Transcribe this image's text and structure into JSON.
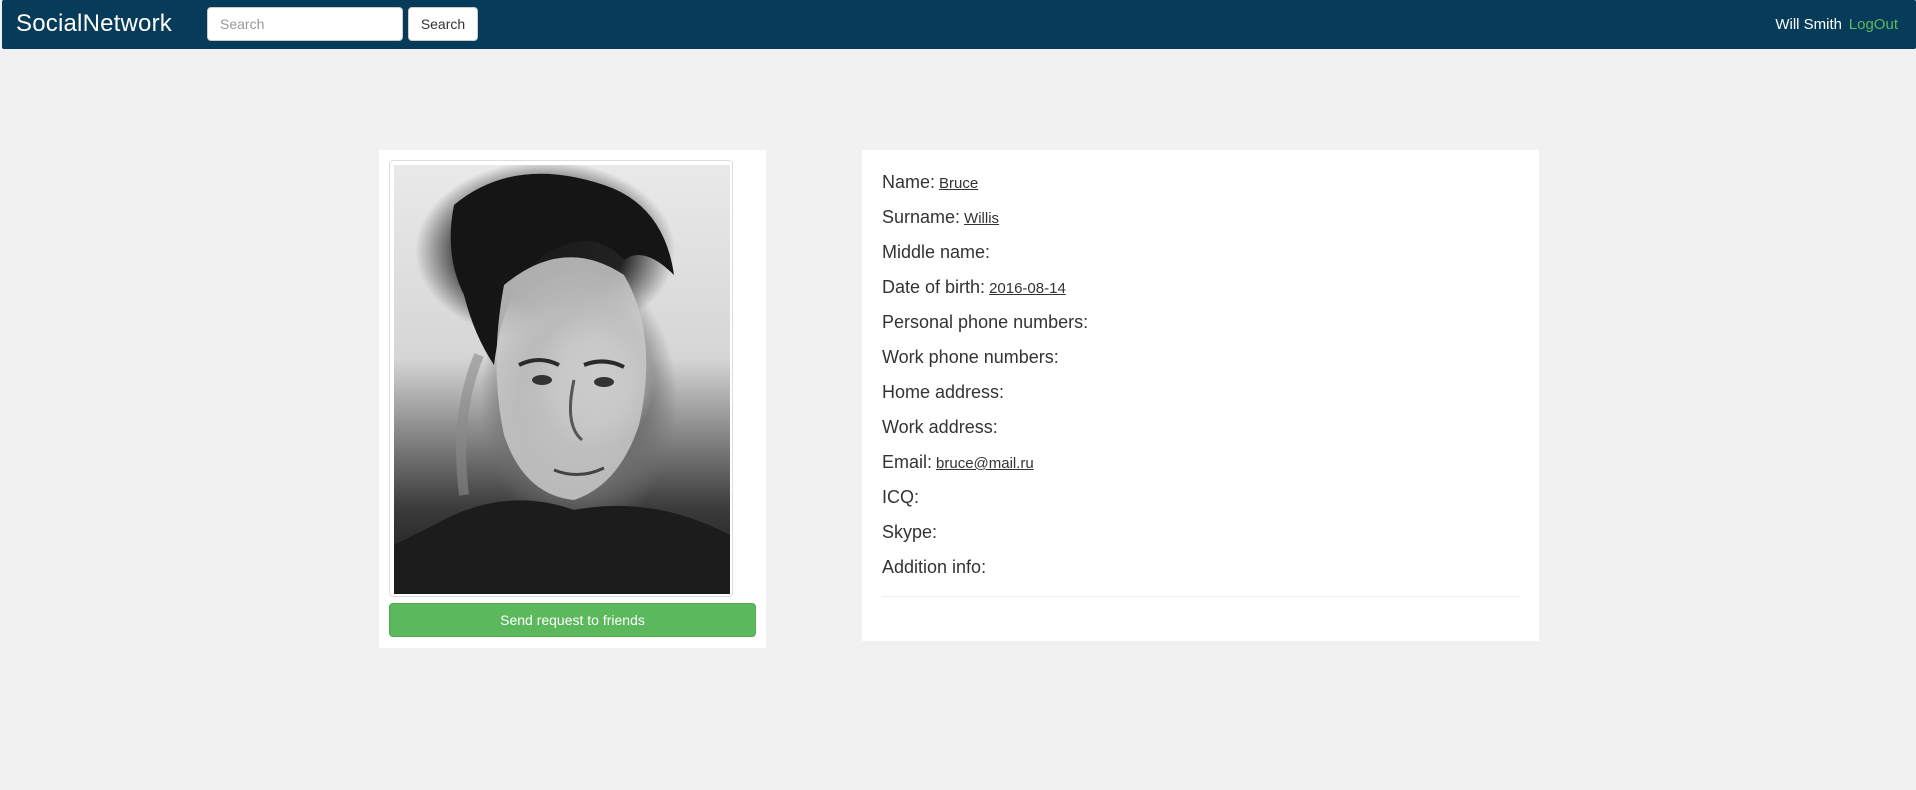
{
  "navbar": {
    "brand": "SocialNetwork",
    "search_placeholder": "Search",
    "search_button": "Search",
    "user_name": "Will Smith",
    "logout": "LogOut"
  },
  "profile": {
    "send_request_button": "Send request to friends",
    "fields": [
      {
        "label": "Name:",
        "value": "Bruce"
      },
      {
        "label": "Surname:",
        "value": "Willis"
      },
      {
        "label": "Middle name:",
        "value": ""
      },
      {
        "label": "Date of birth:",
        "value": "2016-08-14"
      },
      {
        "label": "Personal phone numbers:",
        "value": ""
      },
      {
        "label": "Work phone numbers:",
        "value": ""
      },
      {
        "label": "Home address:",
        "value": ""
      },
      {
        "label": "Work address:",
        "value": ""
      },
      {
        "label": "Email:",
        "value": "bruce@mail.ru"
      },
      {
        "label": "ICQ:",
        "value": ""
      },
      {
        "label": "Skype:",
        "value": ""
      },
      {
        "label": "Addition info:",
        "value": ""
      }
    ]
  },
  "colors": {
    "navbar_bg": "#073b5a",
    "page_bg": "#f1f1f1",
    "accent_green": "#5cb85c"
  }
}
